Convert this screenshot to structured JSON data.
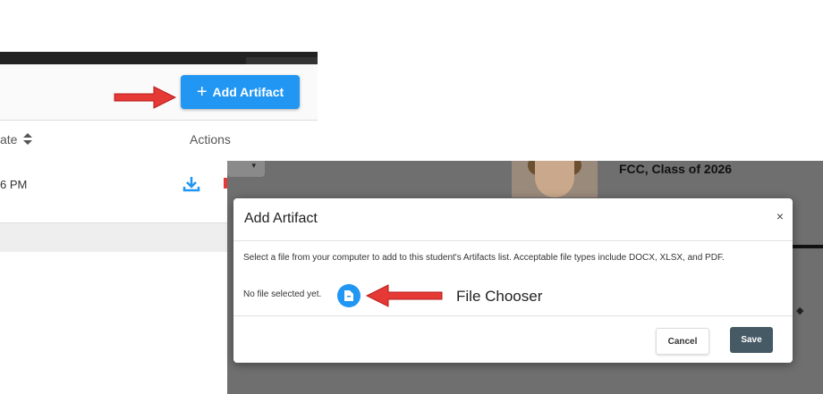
{
  "artifacts_panel": {
    "add_button_label": "Add Artifact",
    "add_button_icon": "plus-icon",
    "columns": {
      "date": "ate",
      "actions": "Actions"
    },
    "sort_icon": "sort-icon",
    "row": {
      "time": "6 PM",
      "download_icon": "download-icon",
      "delete_icon": "trash-icon"
    }
  },
  "background_page": {
    "class_text": "FCC, Class of 2026"
  },
  "modal": {
    "title": "Add Artifact",
    "close": "×",
    "description": "Select a file from your computer to add to this student's Artifacts list. Acceptable file types include DOCX, XLSX, and PDF.",
    "no_file_text": "No file selected yet.",
    "file_button_icon": "file-icon",
    "cancel_label": "Cancel",
    "save_label": "Save"
  },
  "annotations": {
    "file_chooser_label": "File Chooser",
    "arrow_color": "#e53935"
  },
  "colors": {
    "primary": "#2196f3",
    "save": "#455a64"
  }
}
